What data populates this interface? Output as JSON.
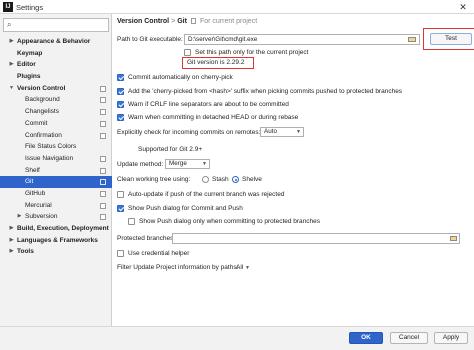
{
  "window": {
    "title": "Settings",
    "app_icon": "IJ",
    "close": "✕"
  },
  "sidebar": {
    "search_placeholder": "",
    "items": [
      {
        "label": "Appearance & Behavior",
        "arrow": "▶"
      },
      {
        "label": "Keymap"
      },
      {
        "label": "Editor",
        "arrow": "▶"
      },
      {
        "label": "Plugins"
      },
      {
        "label": "Version Control",
        "arrow": "▼"
      },
      {
        "label": "Background"
      },
      {
        "label": "Changelists"
      },
      {
        "label": "Commit"
      },
      {
        "label": "Confirmation"
      },
      {
        "label": "File Status Colors"
      },
      {
        "label": "Issue Navigation"
      },
      {
        "label": "Shelf"
      },
      {
        "label": "Git"
      },
      {
        "label": "GitHub"
      },
      {
        "label": "Mercurial"
      },
      {
        "label": "Subversion",
        "arrow": "▶"
      },
      {
        "label": "Build, Execution, Deployment",
        "arrow": "▶"
      },
      {
        "label": "Languages & Frameworks",
        "arrow": "▶"
      },
      {
        "label": "Tools",
        "arrow": "▶"
      }
    ]
  },
  "breadcrumb": {
    "part1": "Version Control",
    "sep": ">",
    "part2": "Git",
    "note": "For current project"
  },
  "git": {
    "path_label": "Path to Git executable:",
    "path_value": "D:\\server\\Git\\cmd\\git.exe",
    "test_label": "Test",
    "set_path_label": "Set this path only for the current project",
    "version_text": "Git version is 2.29.2",
    "commit_cherry_pick": "Commit automatically on cherry-pick",
    "add_cherry_picked": "Add the 'cherry-picked from <hash>' suffix when picking commits pushed to protected branches",
    "warn_crlf": "Warn if CRLF line separators are about to be committed",
    "warn_detached": "Warn when committing in detached HEAD or during rebase",
    "incoming_label": "Explicitly check for incoming commits on remotes:",
    "incoming_value": "Auto",
    "supported_text": "Supported for Git 2.9+",
    "update_method_label": "Update method:",
    "update_method_value": "Merge",
    "clean_tree_label": "Clean working tree using:",
    "stash_label": "Stash",
    "shelve_label": "Shelve",
    "auto_update_label": "Auto-update if push of the current branch was rejected",
    "show_push_label": "Show Push dialog for Commit and Push",
    "show_push_protected_label": "Show Push dialog only when committing to protected branches",
    "protected_label": "Protected branches:",
    "credential_label": "Use credential helper",
    "filter_label": "Filter Update Project information by paths:",
    "filter_value": "All"
  },
  "footer": {
    "ok": "OK",
    "cancel": "Cancel",
    "apply": "Apply"
  },
  "colors": {
    "accent": "#2f65ca",
    "highlight": "#e23232"
  }
}
